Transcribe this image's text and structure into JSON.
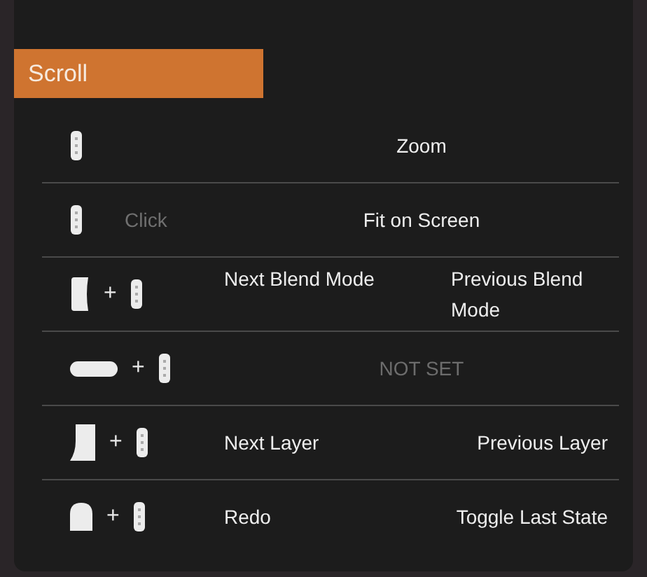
{
  "section": {
    "title": "Scroll"
  },
  "rows": [
    {
      "kind": "single",
      "keys": [
        {
          "kind": "wheel"
        }
      ],
      "action": "Zoom"
    },
    {
      "kind": "single",
      "keys": [
        {
          "kind": "wheel"
        }
      ],
      "modifier": "Click",
      "action": "Fit on Screen"
    },
    {
      "kind": "pair",
      "keys": [
        {
          "kind": "side"
        },
        {
          "kind": "wheel"
        }
      ],
      "joiner": "+",
      "actions": [
        "Next Blend Mode",
        "Previous Blend Mode"
      ]
    },
    {
      "kind": "unset",
      "keys": [
        {
          "kind": "bar"
        },
        {
          "kind": "wheel"
        }
      ],
      "joiner": "+",
      "action": "NOT SET"
    },
    {
      "kind": "pair",
      "keys": [
        {
          "kind": "page"
        },
        {
          "kind": "wheel"
        }
      ],
      "joiner": "+",
      "actions": [
        "Next Layer",
        "Previous Layer"
      ]
    },
    {
      "kind": "pair",
      "keys": [
        {
          "kind": "arch"
        },
        {
          "kind": "wheel"
        }
      ],
      "joiner": "+",
      "actions": [
        "Redo",
        "Toggle Last State"
      ]
    }
  ]
}
